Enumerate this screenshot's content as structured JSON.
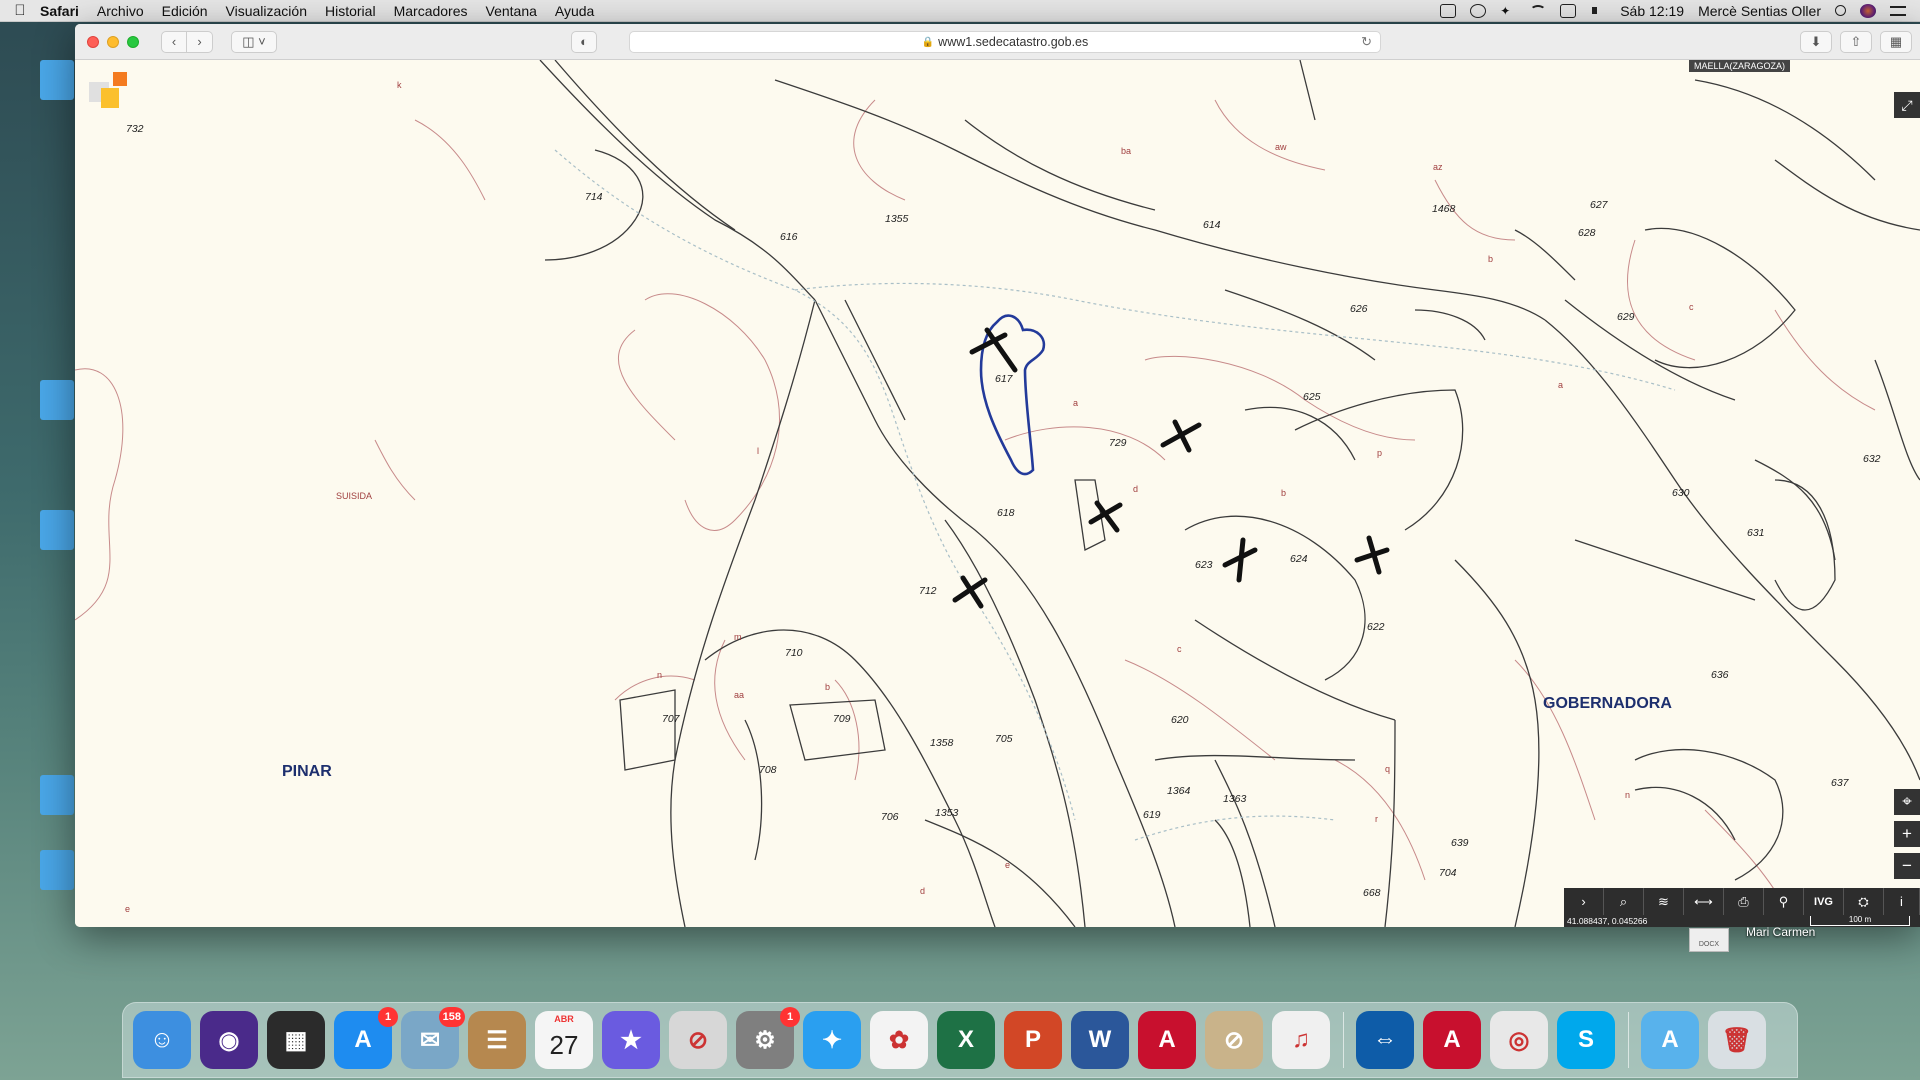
{
  "menubar": {
    "app_name": "Safari",
    "menus": [
      "Archivo",
      "Edición",
      "Visualización",
      "Historial",
      "Marcadores",
      "Ventana",
      "Ayuda"
    ],
    "clock": "Sáb 12:19",
    "user": "Mercè Sentias Oller"
  },
  "browser": {
    "url": "www1.sedecatastro.gob.es"
  },
  "map": {
    "corner_label": "MAELLA(ZARAGOZA)",
    "coords": "41.088437, 0.045266",
    "scale_label": "100 m",
    "toolbar_labels": {
      "next": "›",
      "search": "⌕",
      "layers": "≋",
      "measure": "⟷",
      "print": "⎙",
      "pin": "⚲",
      "ivg": "IVG",
      "layers2": "⛭",
      "info": "i"
    },
    "place_names": {
      "pinar": "PINAR",
      "gobernadora": "GOBERNADORA",
      "suisida": "SUISIDA"
    },
    "parcels": [
      {
        "id": "p732",
        "label": "732"
      },
      {
        "id": "p714",
        "label": "714"
      },
      {
        "id": "p616",
        "label": "616"
      },
      {
        "id": "p1355",
        "label": "1355"
      },
      {
        "id": "p614",
        "label": "614"
      },
      {
        "id": "p1468",
        "label": "1468"
      },
      {
        "id": "p627",
        "label": "627"
      },
      {
        "id": "p628",
        "label": "628"
      },
      {
        "id": "p626",
        "label": "626"
      },
      {
        "id": "p629",
        "label": "629"
      },
      {
        "id": "p625",
        "label": "625"
      },
      {
        "id": "p617",
        "label": "617"
      },
      {
        "id": "p729",
        "label": "729"
      },
      {
        "id": "p618",
        "label": "618"
      },
      {
        "id": "p630",
        "label": "630"
      },
      {
        "id": "p632",
        "label": "632"
      },
      {
        "id": "p631",
        "label": "631"
      },
      {
        "id": "p623",
        "label": "623"
      },
      {
        "id": "p624",
        "label": "624"
      },
      {
        "id": "p712",
        "label": "712"
      },
      {
        "id": "p622",
        "label": "622"
      },
      {
        "id": "p710",
        "label": "710"
      },
      {
        "id": "p636",
        "label": "636"
      },
      {
        "id": "p707",
        "label": "707"
      },
      {
        "id": "p709",
        "label": "709"
      },
      {
        "id": "p620",
        "label": "620"
      },
      {
        "id": "p708",
        "label": "708"
      },
      {
        "id": "p1358",
        "label": "1358"
      },
      {
        "id": "p705",
        "label": "705"
      },
      {
        "id": "p637",
        "label": "637"
      },
      {
        "id": "p706",
        "label": "706"
      },
      {
        "id": "p1353",
        "label": "1353"
      },
      {
        "id": "p1364",
        "label": "1364"
      },
      {
        "id": "p1363",
        "label": "1363"
      },
      {
        "id": "p619",
        "label": "619"
      },
      {
        "id": "p639",
        "label": "639"
      },
      {
        "id": "p704",
        "label": "704"
      },
      {
        "id": "p668",
        "label": "668"
      }
    ],
    "subparcel_letters": [
      "k",
      "ba",
      "aw",
      "az",
      "b",
      "c",
      "a",
      "l",
      "a",
      "d",
      "p",
      "b",
      "m",
      "aa",
      "n",
      "b",
      "e",
      "d",
      "c",
      "q",
      "r",
      "n",
      "e"
    ]
  },
  "desktop": {
    "file_label": "Mari Carmen",
    "file_type": "DOCX"
  },
  "dock": {
    "items": [
      {
        "name": "finder",
        "label": "☺",
        "color": "#3d8fe0"
      },
      {
        "name": "siri",
        "label": "◉",
        "color": "#4a2a8a"
      },
      {
        "name": "mission-control",
        "label": "▦",
        "color": "#2b2b2b"
      },
      {
        "name": "app-store",
        "label": "A",
        "color": "#1e8cf0",
        "badge": "1"
      },
      {
        "name": "mail",
        "label": "✉",
        "color": "#7aa7c7",
        "badge": "158"
      },
      {
        "name": "contacts",
        "label": "☰",
        "color": "#b6884f"
      },
      {
        "name": "calendar",
        "label": "27",
        "color": "#f5f5f5",
        "sub": "ABR"
      },
      {
        "name": "imovie",
        "label": "★",
        "color": "#6a5be0"
      },
      {
        "name": "disabled-app",
        "label": "⊘",
        "color": "#d7d7d7"
      },
      {
        "name": "system-preferences",
        "label": "⚙",
        "color": "#7f7f7f",
        "badge": "1"
      },
      {
        "name": "safari",
        "label": "✦",
        "color": "#2a9ff0"
      },
      {
        "name": "photos",
        "label": "✿",
        "color": "#f3f3f3"
      },
      {
        "name": "excel",
        "label": "X",
        "color": "#1e7145"
      },
      {
        "name": "powerpoint",
        "label": "P",
        "color": "#d24726"
      },
      {
        "name": "word",
        "label": "W",
        "color": "#2b579a"
      },
      {
        "name": "acrobat",
        "label": "A",
        "color": "#c8102e"
      },
      {
        "name": "disabled-app-2",
        "label": "⊘",
        "color": "#c9b38a"
      },
      {
        "name": "itunes",
        "label": "♫",
        "color": "#f0f0f0"
      },
      {
        "name": "teamviewer",
        "label": "⇔",
        "color": "#0e5ca8"
      },
      {
        "name": "acrobat-reader",
        "label": "A",
        "color": "#c8102e"
      },
      {
        "name": "chrome",
        "label": "◎",
        "color": "#e8e8e8"
      },
      {
        "name": "skype",
        "label": "S",
        "color": "#00a8ec"
      },
      {
        "name": "applications-folder",
        "label": "A",
        "color": "#58b2ec"
      },
      {
        "name": "trash",
        "label": "🗑",
        "color": "#d9dfe3"
      }
    ]
  }
}
